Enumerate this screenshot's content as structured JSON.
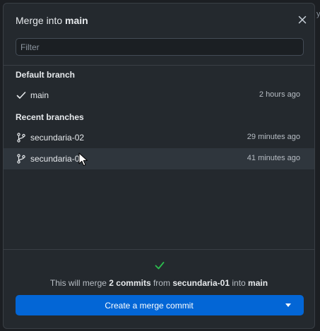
{
  "dialog": {
    "title_prefix": "Merge into ",
    "title_branch": "main"
  },
  "filter": {
    "placeholder": "Filter",
    "value": ""
  },
  "default_branch": {
    "section_title": "Default branch",
    "items": [
      {
        "name": "main",
        "time": "2 hours ago",
        "icon": "check-icon"
      }
    ]
  },
  "recent_branches": {
    "section_title": "Recent branches",
    "items": [
      {
        "name": "secundaria-02",
        "time": "29 minutes ago",
        "icon": "git-branch-icon"
      },
      {
        "name": "secundaria-01",
        "time": "41 minutes ago",
        "icon": "git-branch-icon",
        "hovered": true
      }
    ]
  },
  "footer": {
    "status_icon": "check-icon",
    "status_color": "#2cbe4e",
    "text_before": "This will merge ",
    "commit_count": "2 commits",
    "text_from": " from ",
    "source_branch": "secundaria-01",
    "text_into": " into ",
    "target_branch": "main",
    "button_label": "Create a merge commit",
    "button_color": "#0366d6"
  },
  "edge_text": "y"
}
